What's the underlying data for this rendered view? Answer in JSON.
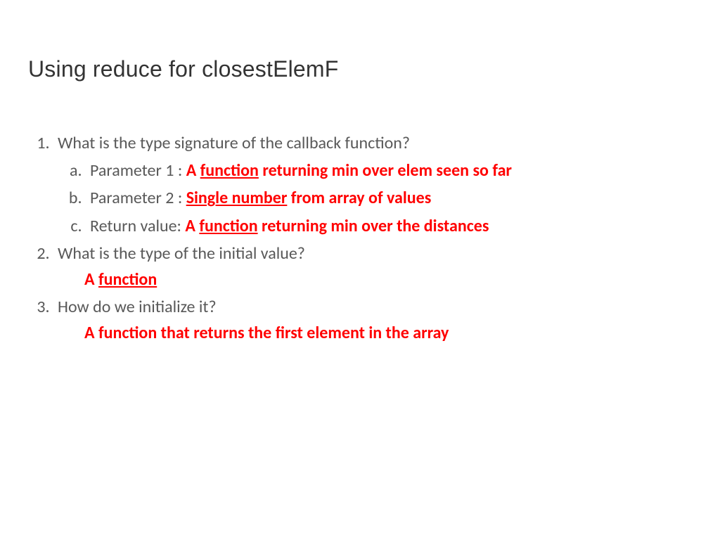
{
  "title": "Using reduce for closestElemF",
  "items": [
    {
      "question": "What is the type signature of the callback function?",
      "sub": [
        {
          "label": "Parameter 1 : ",
          "ans_pre": "A ",
          "ans_u": "function",
          "ans_post": " returning min over elem seen so far"
        },
        {
          "label": "Parameter 2 : ",
          "ans_pre": "",
          "ans_u": "Single number",
          "ans_post": " from array of values"
        },
        {
          "label": "Return value: ",
          "ans_pre": "A ",
          "ans_u": "function",
          "ans_post": " returning min over the distances"
        }
      ]
    },
    {
      "question": "What is the type of the initial value?",
      "answer_pre": "A ",
      "answer_u": "function",
      "answer_post": ""
    },
    {
      "question": "How do we initialize it?",
      "answer_pre": "A function that returns the first element in the array",
      "answer_u": "",
      "answer_post": ""
    }
  ]
}
